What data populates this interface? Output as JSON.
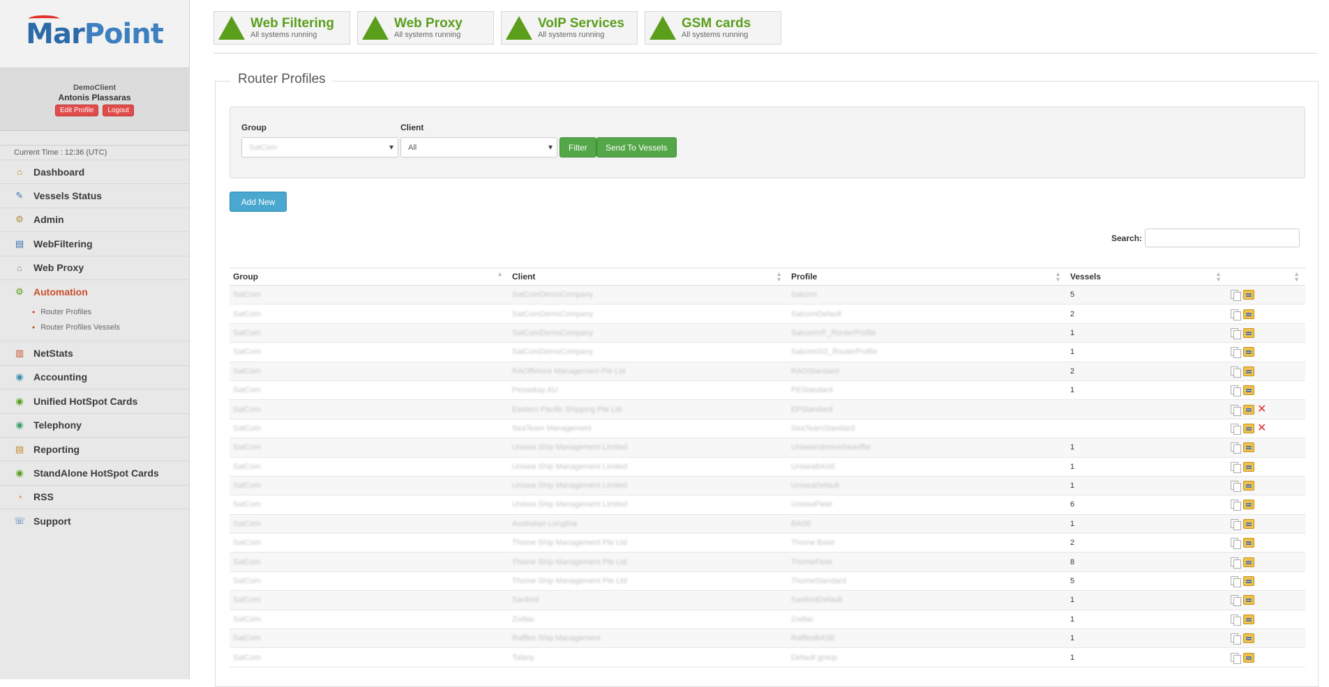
{
  "brand": {
    "part1": "Mar",
    "part2": "Point"
  },
  "user": {
    "client": "DemoClient",
    "name": "Antonis Plassaras",
    "edit_label": "Edit Profile",
    "logout_label": "Logout"
  },
  "current_time": "Current Time : 12:36 (UTC)",
  "nav": [
    {
      "label": "Dashboard",
      "icon": "home-icon",
      "glyph": "⌂",
      "color": "#c48a2a"
    },
    {
      "label": "Vessels Status",
      "icon": "satellite-icon",
      "glyph": "✎",
      "color": "#3b6fb0"
    },
    {
      "label": "Admin",
      "icon": "gear-icon",
      "glyph": "⚙",
      "color": "#b08a3a"
    },
    {
      "label": "WebFiltering",
      "icon": "document-icon",
      "glyph": "▤",
      "color": "#3b6fb0"
    },
    {
      "label": "Web Proxy",
      "icon": "network-icon",
      "glyph": "⌂",
      "color": "#888888"
    },
    {
      "label": "Automation",
      "icon": "automation-icon",
      "glyph": "⚙",
      "color": "#5a9e1c",
      "active": true
    },
    {
      "label": "NetStats",
      "icon": "bar-chart-icon",
      "glyph": "▥",
      "color": "#c9502a"
    },
    {
      "label": "Accounting",
      "icon": "globe-coins-icon",
      "glyph": "◉",
      "color": "#3b8fb0"
    },
    {
      "label": "Unified HotSpot Cards",
      "icon": "globe-card-icon",
      "glyph": "◉",
      "color": "#5a9e1c"
    },
    {
      "label": "Telephony",
      "icon": "globe-phone-icon",
      "glyph": "◉",
      "color": "#3b9f6f"
    },
    {
      "label": "Reporting",
      "icon": "report-icon",
      "glyph": "▤",
      "color": "#c48a2a"
    },
    {
      "label": "StandAlone HotSpot Cards",
      "icon": "globe-card-icon",
      "glyph": "◉",
      "color": "#5a9e1c"
    },
    {
      "label": "RSS",
      "icon": "rss-icon",
      "glyph": "◔",
      "color": "#e8862a"
    },
    {
      "label": "Support",
      "icon": "support-icon",
      "glyph": "☏",
      "color": "#3b6fb0"
    }
  ],
  "automation_sub": [
    "Router Profiles",
    "Router Profiles Vessels"
  ],
  "status_cards": [
    {
      "name": "Web Filtering",
      "sub": "All systems running"
    },
    {
      "name": "Web Proxy",
      "sub": "All systems running"
    },
    {
      "name": "VoIP Services",
      "sub": "All systems running"
    },
    {
      "name": "GSM cards",
      "sub": "All systems running"
    }
  ],
  "panel_title": "Router Profiles",
  "filter": {
    "group_label": "Group",
    "group_value": "SatCom",
    "client_label": "Client",
    "client_value": "All",
    "filter_label": "Filter",
    "send_label": "Send To Vessels"
  },
  "add_new_label": "Add New",
  "search_label": "Search:",
  "table": {
    "headers": [
      "Group",
      "Client",
      "Profile",
      "Vessels",
      ""
    ],
    "rows": [
      {
        "group": "SatCom",
        "client": "SatComDemoCompany",
        "profile": "Satcom",
        "vessels": "5",
        "del": false
      },
      {
        "group": "SatCom",
        "client": "SatComDemoCompany",
        "profile": "SatcomDefault",
        "vessels": "2",
        "del": false
      },
      {
        "group": "SatCom",
        "client": "SatComDemoCompany",
        "profile": "SatcomVF_RouterProfile",
        "vessels": "1",
        "del": false
      },
      {
        "group": "SatCom",
        "client": "SatComDemoCompany",
        "profile": "SatcomSG_RouterProfile",
        "vessels": "1",
        "del": false
      },
      {
        "group": "SatCom",
        "client": "RAOffshore Management Pte Ltd",
        "profile": "RAOStandard",
        "vessels": "2",
        "del": false
      },
      {
        "group": "SatCom",
        "client": "Pesaskay AU",
        "profile": "PEStandard",
        "vessels": "1",
        "del": false
      },
      {
        "group": "SatCom",
        "client": "Eastern Pacific Shipping Pte Ltd",
        "profile": "EPStandard",
        "vessels": "",
        "del": true
      },
      {
        "group": "SatCom",
        "client": "SeaTeam Management",
        "profile": "SeaTeamStandard",
        "vessels": "",
        "del": true
      },
      {
        "group": "SatCom",
        "client": "Unisea Ship Management Limited",
        "profile": "UniseandmoveSeaoffer",
        "vessels": "1",
        "del": false
      },
      {
        "group": "SatCom",
        "client": "Unisea Ship Management Limited",
        "profile": "UniseaBASE",
        "vessels": "1",
        "del": false
      },
      {
        "group": "SatCom",
        "client": "Unisea Ship Management Limited",
        "profile": "UniseaDefault",
        "vessels": "1",
        "del": false
      },
      {
        "group": "SatCom",
        "client": "Unisea Ship Management Limited",
        "profile": "UniseaFleet",
        "vessels": "6",
        "del": false
      },
      {
        "group": "SatCom",
        "client": "Australian Longline",
        "profile": "BASE",
        "vessels": "1",
        "del": false
      },
      {
        "group": "SatCom",
        "client": "Thome Ship Management Pte Ltd",
        "profile": "Thome Base",
        "vessels": "2",
        "del": false
      },
      {
        "group": "SatCom",
        "client": "Thome Ship Management Pte Ltd",
        "profile": "ThomeFleet",
        "vessels": "8",
        "del": false
      },
      {
        "group": "SatCom",
        "client": "Thome Ship Management Pte Ltd",
        "profile": "ThomeStandard",
        "vessels": "5",
        "del": false
      },
      {
        "group": "SatCom",
        "client": "Sanford",
        "profile": "SanfordDefault",
        "vessels": "1",
        "del": false
      },
      {
        "group": "SatCom",
        "client": "Zodiac",
        "profile": "Zodiac",
        "vessels": "1",
        "del": false
      },
      {
        "group": "SatCom",
        "client": "Raffles Ship Management",
        "profile": "RafflesBASE",
        "vessels": "1",
        "del": false
      },
      {
        "group": "SatCom",
        "client": "Talaoy",
        "profile": "Default group",
        "vessels": "1",
        "del": false
      }
    ]
  }
}
